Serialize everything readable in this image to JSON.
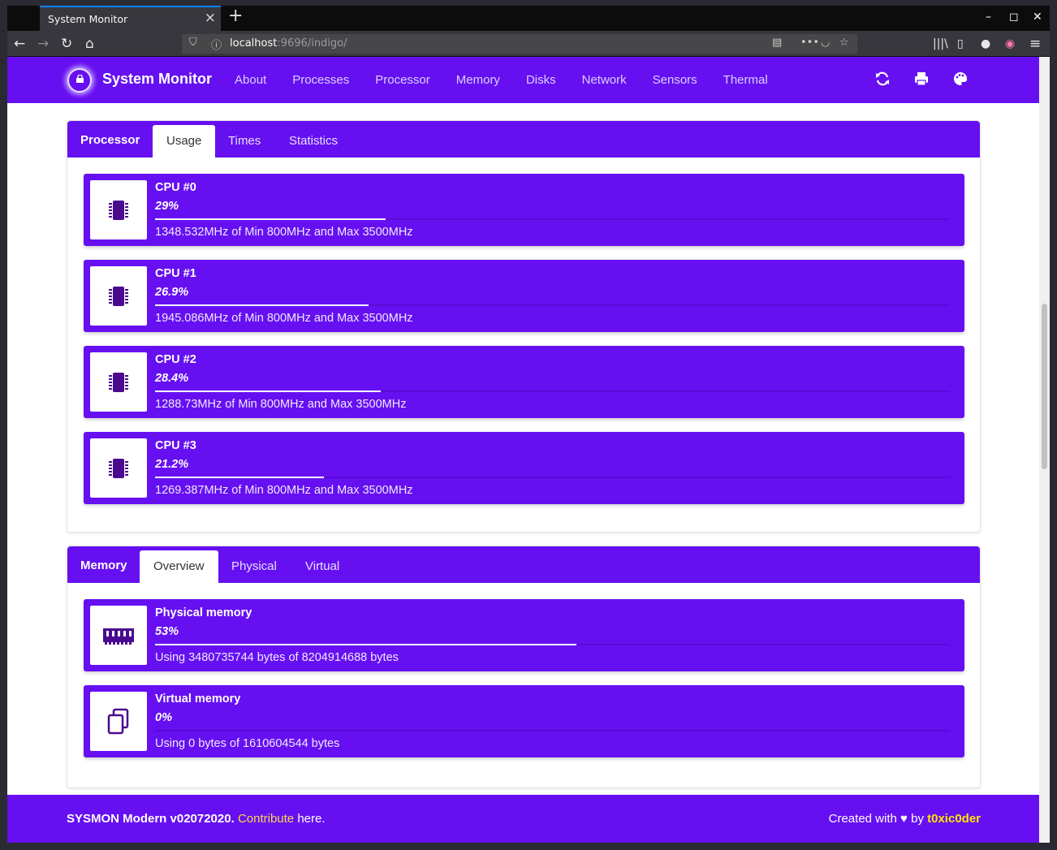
{
  "browser": {
    "tab_title": "System Monitor",
    "url_host": "localhost",
    "url_rest": ":9696/indigo/"
  },
  "app": {
    "brand": "System Monitor",
    "nav": [
      "About",
      "Processes",
      "Processor",
      "Memory",
      "Disks",
      "Network",
      "Sensors",
      "Thermal"
    ],
    "actions": [
      "refresh-icon",
      "print-icon",
      "palette-icon"
    ]
  },
  "processor": {
    "title": "Processor",
    "tabs": [
      "Usage",
      "Times",
      "Statistics"
    ],
    "active_tab": "Usage",
    "cpus": [
      {
        "name": "CPU #0",
        "percent": "29%",
        "value": 29,
        "detail": "1348.532MHz of Min 800MHz and Max 3500MHz"
      },
      {
        "name": "CPU #1",
        "percent": "26.9%",
        "value": 26.9,
        "detail": "1945.086MHz of Min 800MHz and Max 3500MHz"
      },
      {
        "name": "CPU #2",
        "percent": "28.4%",
        "value": 28.4,
        "detail": "1288.73MHz of Min 800MHz and Max 3500MHz"
      },
      {
        "name": "CPU #3",
        "percent": "21.2%",
        "value": 21.2,
        "detail": "1269.387MHz of Min 800MHz and Max 3500MHz"
      }
    ]
  },
  "memory": {
    "title": "Memory",
    "tabs": [
      "Overview",
      "Physical",
      "Virtual"
    ],
    "active_tab": "Overview",
    "items": [
      {
        "name": "Physical memory",
        "percent": "53%",
        "value": 53,
        "detail": "Using 3480735744 bytes of 8204914688 bytes",
        "icon": "ram-icon"
      },
      {
        "name": "Virtual memory",
        "percent": "0%",
        "value": 0,
        "detail": "Using 0 bytes of 1610604544 bytes",
        "icon": "copy-icon"
      }
    ]
  },
  "footer": {
    "product": "SYSMON Modern v02072020.",
    "contribute": "Contribute",
    "here": "here.",
    "created_with": "Created with",
    "by": "by",
    "author": "t0xic0der"
  },
  "colors": {
    "accent": "#6610f2",
    "icon": "#4a0a8f",
    "link": "#ffd54a"
  }
}
